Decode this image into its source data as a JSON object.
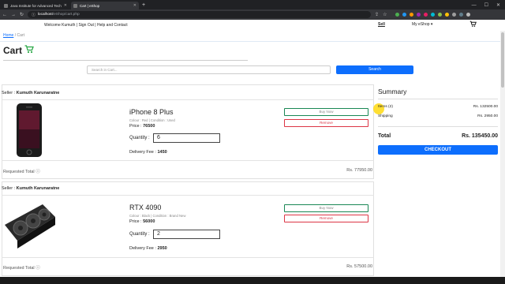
{
  "browser": {
    "tabs": [
      {
        "title": "Java Institute for Advanced Tech..."
      },
      {
        "title": "Cart | eShop"
      }
    ],
    "url_host": "localhost",
    "url_path": "/eShop/cart.php"
  },
  "nav": {
    "welcome": "Welcome",
    "user": "Kumuth",
    "links": "| Sign Out | Help and Contact",
    "sell": "Sell",
    "myeshop": "My eShop"
  },
  "breadcrumb": {
    "home": "Home",
    "sep": "/",
    "current": "Cart"
  },
  "page": {
    "title": "Cart"
  },
  "search": {
    "placeholder": "Search in Cart...",
    "button": "Search"
  },
  "items": [
    {
      "seller_label": "Seller :",
      "seller": "Kumuth Karunaratne",
      "name": "iPhone 8 Plus",
      "meta": "Colour : Red   |   Condition : Used",
      "price_label": "Price :",
      "price": "76500",
      "qty_label": "Quantity :",
      "qty": "6",
      "delivery_label": "Delivery Fee :",
      "delivery": "1450",
      "buy": "Buy Now",
      "remove": "Remove",
      "requested_label": "Requested Total",
      "requested": "Rs. 77950.00"
    },
    {
      "seller_label": "Seller :",
      "seller": "Kumuth Karunaratne",
      "name": "RTX 4090",
      "meta": "Colour : Black   |   Condition : Brand New",
      "price_label": "Price :",
      "price": "56000",
      "qty_label": "Quantity :",
      "qty": "2",
      "delivery_label": "Delivery Fee :",
      "delivery": "2950",
      "buy": "Buy Now",
      "remove": "Remove",
      "requested_label": "Requested Total",
      "requested": "Rs. 57500.00"
    }
  ],
  "summary": {
    "title": "Summary",
    "items_label": "Items (2)",
    "items_value": "Rs. 132500.00",
    "shipping_label": "Shipping",
    "shipping_value": "Rs. 2950.00",
    "total_label": "Total",
    "total_value": "Rs. 135450.00",
    "checkout": "CHECKOUT"
  },
  "colors": {
    "primary": "#0d6efd",
    "success": "#198754",
    "danger": "#dc3545",
    "cart_icon": "#28a745"
  }
}
